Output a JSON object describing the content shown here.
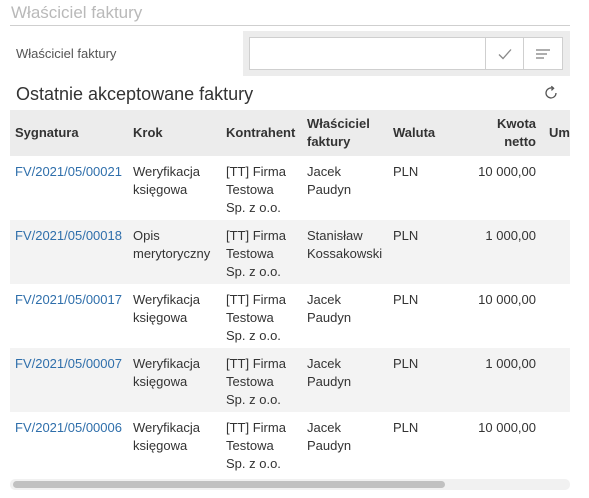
{
  "page": {
    "title": "Właściciel faktury"
  },
  "filter": {
    "label": "Właściciel faktury",
    "value": "",
    "placeholder": "",
    "accept_icon": "check-icon",
    "list_icon": "list-lines-icon"
  },
  "section": {
    "title": "Ostatnie akceptowane faktury",
    "refresh_icon": "refresh-icon"
  },
  "table": {
    "headers": {
      "sygnatura": "Sygnatura",
      "krok": "Krok",
      "kontrahent": "Kontrahent",
      "wlasciciel_l1": "Właściciel",
      "wlasciciel_l2": "faktury",
      "waluta": "Waluta",
      "kwota_l1": "Kwota",
      "kwota_l2": "netto",
      "umowa": "Umowa"
    },
    "rows": [
      {
        "sygnatura": "FV/2021/05/00021",
        "krok_l1": "Weryfikacja",
        "krok_l2": "księgowa",
        "kontr_l1": "[TT] Firma",
        "kontr_l2": "Testowa",
        "kontr_l3": "Sp. z o.o.",
        "wlasc_l1": "Jacek",
        "wlasc_l2": "Paudyn",
        "waluta": "PLN",
        "kwota": "10 000,00",
        "umowa": ""
      },
      {
        "sygnatura": "FV/2021/05/00018",
        "krok_l1": "Opis",
        "krok_l2": "merytoryczny",
        "kontr_l1": "[TT] Firma",
        "kontr_l2": "Testowa",
        "kontr_l3": "Sp. z o.o.",
        "wlasc_l1": "Stanisław",
        "wlasc_l2": "Kossakowski",
        "waluta": "PLN",
        "kwota": "1 000,00",
        "umowa": ""
      },
      {
        "sygnatura": "FV/2021/05/00017",
        "krok_l1": "Weryfikacja",
        "krok_l2": "księgowa",
        "kontr_l1": "[TT] Firma",
        "kontr_l2": "Testowa",
        "kontr_l3": "Sp. z o.o.",
        "wlasc_l1": "Jacek",
        "wlasc_l2": "Paudyn",
        "waluta": "PLN",
        "kwota": "10 000,00",
        "umowa": ""
      },
      {
        "sygnatura": "FV/2021/05/00007",
        "krok_l1": "Weryfikacja",
        "krok_l2": "księgowa",
        "kontr_l1": "[TT] Firma",
        "kontr_l2": "Testowa",
        "kontr_l3": "Sp. z o.o.",
        "wlasc_l1": "Jacek",
        "wlasc_l2": "Paudyn",
        "waluta": "PLN",
        "kwota": "1 000,00",
        "umowa": ""
      },
      {
        "sygnatura": "FV/2021/05/00006",
        "krok_l1": "Weryfikacja",
        "krok_l2": "księgowa",
        "kontr_l1": "[TT] Firma",
        "kontr_l2": "Testowa",
        "kontr_l3": "Sp. z o.o.",
        "wlasc_l1": "Jacek",
        "wlasc_l2": "Paudyn",
        "waluta": "PLN",
        "kwota": "10 000,00",
        "umowa": ""
      }
    ]
  },
  "colors": {
    "link": "#2f6fab",
    "header_bg": "#ececec",
    "stripe_bg": "#f3f3f3",
    "muted_title": "#b9b9b9"
  }
}
